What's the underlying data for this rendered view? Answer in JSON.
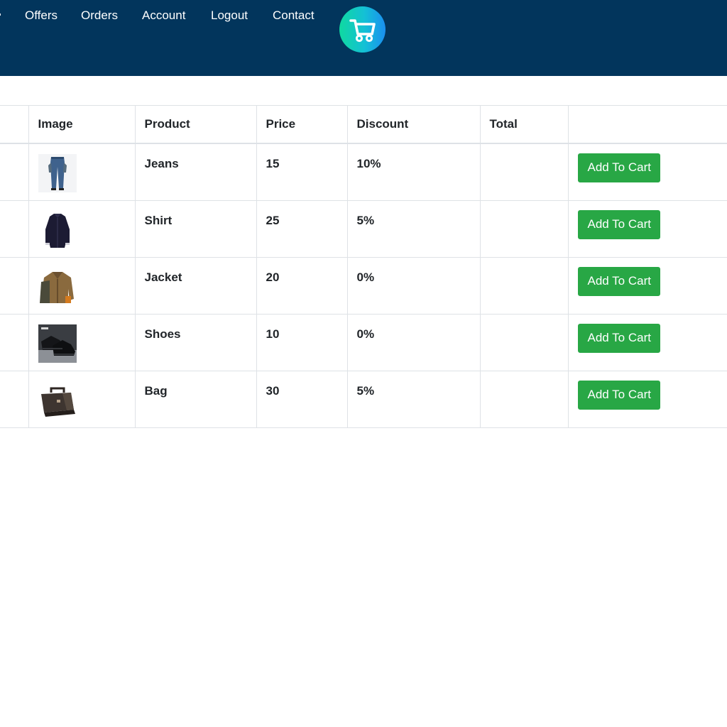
{
  "nav": {
    "links": [
      "Offers",
      "Orders",
      "Account",
      "Logout",
      "Contact"
    ],
    "logo_icon": "shopping-cart-icon",
    "background": "#02355c"
  },
  "table": {
    "headers": [
      "",
      "Image",
      "Product",
      "Price",
      "Discount",
      "Total",
      ""
    ],
    "rows": [
      {
        "image_icon": "jeans-image",
        "product": "Jeans",
        "price": "15",
        "discount": "10%",
        "total": "",
        "button": "Add To Cart"
      },
      {
        "image_icon": "shirt-image",
        "product": "Shirt",
        "price": "25",
        "discount": "5%",
        "total": "",
        "button": "Add To Cart"
      },
      {
        "image_icon": "jacket-image",
        "product": "Jacket",
        "price": "20",
        "discount": "0%",
        "total": "",
        "button": "Add To Cart"
      },
      {
        "image_icon": "shoes-image",
        "product": "Shoes",
        "price": "10",
        "discount": "0%",
        "total": "",
        "button": "Add To Cart"
      },
      {
        "image_icon": "bag-image",
        "product": "Bag",
        "price": "30",
        "discount": "5%",
        "total": "",
        "button": "Add To Cart"
      }
    ]
  },
  "colors": {
    "button": "#28a745",
    "logo_gradient_start": "#10d9a0",
    "logo_gradient_end": "#1a8ff0"
  }
}
